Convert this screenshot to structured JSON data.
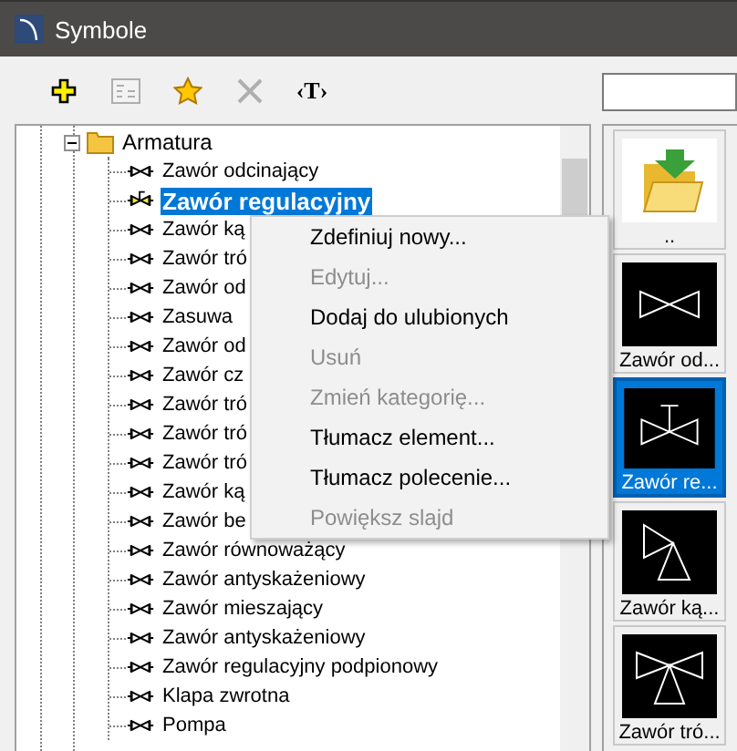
{
  "window": {
    "title": "Symbole"
  },
  "toolbar": [
    {
      "kind": "add",
      "disabled": false
    },
    {
      "kind": "properties",
      "disabled": true
    },
    {
      "kind": "favorite",
      "disabled": false
    },
    {
      "kind": "delete",
      "disabled": true
    },
    {
      "kind": "text",
      "label": "‹T›",
      "disabled": false
    }
  ],
  "tree": {
    "items": [
      {
        "label": "Armatura",
        "expanded": true,
        "children": [
          {
            "label": "Zawór odcinający",
            "selected": false
          },
          {
            "label": "Zawór regulacyjny",
            "selected": true
          },
          {
            "label": "Zawór ką",
            "selected": false
          },
          {
            "label": "Zawór tró",
            "selected": false
          },
          {
            "label": "Zawór od",
            "selected": false
          },
          {
            "label": "Zasuwa",
            "selected": false
          },
          {
            "label": "Zawór od",
            "selected": false
          },
          {
            "label": "Zawór cz",
            "selected": false
          },
          {
            "label": "Zawór tró",
            "selected": false
          },
          {
            "label": "Zawór tró",
            "selected": false
          },
          {
            "label": "Zawór tró",
            "selected": false
          },
          {
            "label": "Zawór ką",
            "selected": false
          },
          {
            "label": "Zawór be",
            "selected": false
          },
          {
            "label": "Zawór równoważący",
            "selected": false
          },
          {
            "label": "Zawór antyskażeniowy",
            "selected": false
          },
          {
            "label": "Zawór mieszający",
            "selected": false
          },
          {
            "label": "Zawór antyskażeniowy",
            "selected": false
          },
          {
            "label": "Zawór regulacyjny podpionowy",
            "selected": false
          },
          {
            "label": "Klapa zwrotna",
            "selected": false
          },
          {
            "label": "Pompa",
            "selected": false
          }
        ]
      }
    ]
  },
  "context_menu": {
    "items": [
      {
        "label": "Zdefiniuj nowy...",
        "disabled": false
      },
      {
        "label": "Edytuj...",
        "disabled": true
      },
      {
        "label": "Dodaj do ulubionych",
        "disabled": false
      },
      {
        "label": "Usuń",
        "disabled": true
      },
      {
        "label": "Zmień kategorię...",
        "disabled": true
      },
      {
        "label": "Tłumacz element...",
        "disabled": false
      },
      {
        "label": "Tłumacz polecenie...",
        "disabled": false
      },
      {
        "label": "Powiększ slajd",
        "disabled": true
      }
    ]
  },
  "thumbnails": [
    {
      "kind": "folder",
      "label": "..",
      "selected": false
    },
    {
      "kind": "valve",
      "label": "Zawór od...",
      "selected": false
    },
    {
      "kind": "regulating",
      "label": "Zawór re...",
      "selected": true
    },
    {
      "kind": "angle",
      "label": "Zawór ką...",
      "selected": false
    },
    {
      "kind": "three_way",
      "label": "Zawór tró...",
      "selected": false
    }
  ]
}
